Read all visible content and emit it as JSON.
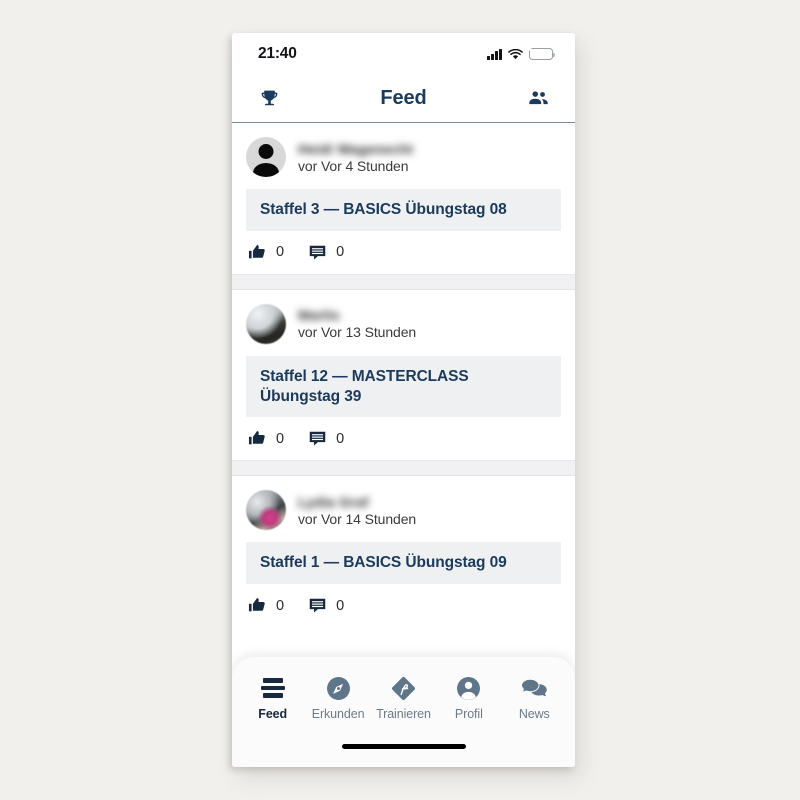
{
  "status_bar": {
    "time": "21:40",
    "icons": [
      "signal-icon",
      "wifi-icon",
      "battery-charging-icon"
    ],
    "battery_color": "#2ecc40"
  },
  "header": {
    "title": "Feed",
    "left_icon": "trophy-icon",
    "right_icon": "people-icon",
    "title_color": "#1b3a5c"
  },
  "feed": {
    "posts": [
      {
        "author": "Heidi Wagenecht",
        "time": "vor Vor 4 Stunden",
        "title": "Staffel 3 — BASICS Übungstag 08",
        "avatar": "default-avatar",
        "likes": "0",
        "comments": "0"
      },
      {
        "author": "Marlis",
        "time": "vor Vor 13 Stunden",
        "title": "Staffel 12 — MASTERCLASS Übungstag 39",
        "avatar": "photo-avatar",
        "likes": "0",
        "comments": "0"
      },
      {
        "author": "Lydia Graf",
        "time": "vor Vor 14 Stunden",
        "title": "Staffel 1 — BASICS Übungstag 09",
        "avatar": "photo-avatar",
        "likes": "0",
        "comments": "0"
      }
    ]
  },
  "tab_bar": {
    "items": [
      {
        "label": "Feed",
        "icon": "feed-lines-icon",
        "active": true
      },
      {
        "label": "Erkunden",
        "icon": "compass-icon",
        "active": false
      },
      {
        "label": "Trainieren",
        "icon": "diamond-p-icon",
        "active": false
      },
      {
        "label": "Profil",
        "icon": "person-icon",
        "active": false
      },
      {
        "label": "News",
        "icon": "chat-bubbles-icon",
        "active": false
      }
    ],
    "active_color": "#16293f",
    "inactive_color": "#6d7b88",
    "home_indicator": "home-indicator"
  }
}
